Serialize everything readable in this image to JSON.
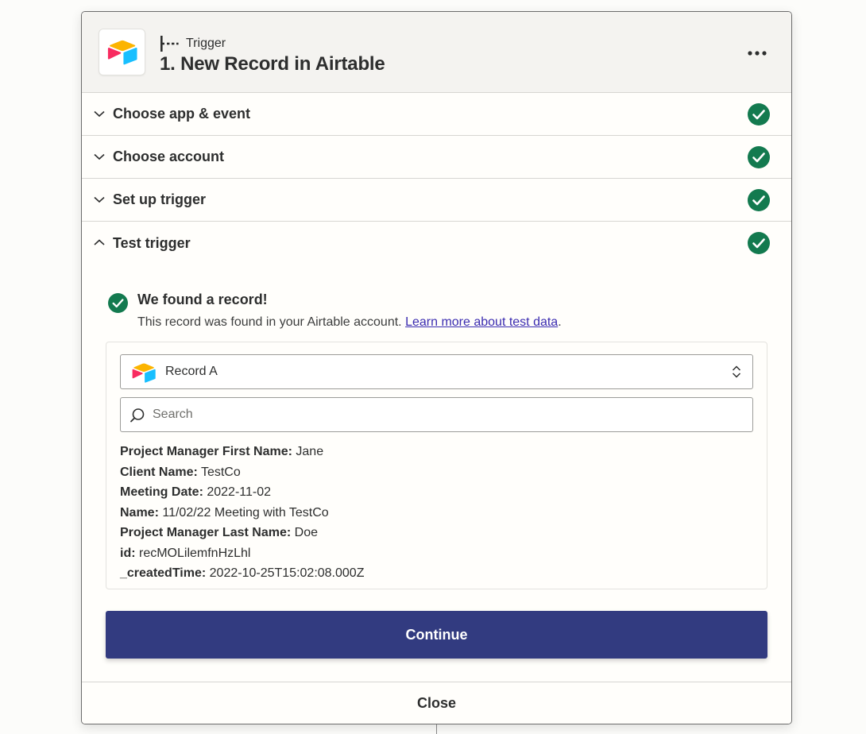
{
  "step": {
    "kind_label": "Trigger",
    "title": "1. New Record in Airtable",
    "app_icon": "airtable-logo"
  },
  "sections": [
    {
      "label": "Choose app & event",
      "expanded": false,
      "complete": true
    },
    {
      "label": "Choose account",
      "expanded": false,
      "complete": true
    },
    {
      "label": "Set up trigger",
      "expanded": false,
      "complete": true
    },
    {
      "label": "Test trigger",
      "expanded": true,
      "complete": true
    }
  ],
  "test_result": {
    "title": "We found a record!",
    "description": "This record was found in your Airtable account.",
    "link_text": "Learn more about test data",
    "link_suffix": "."
  },
  "record_select": {
    "value": "Record A"
  },
  "search": {
    "placeholder": "Search",
    "value": ""
  },
  "fields": [
    {
      "key": "Project Manager First Name:",
      "value": "Jane"
    },
    {
      "key": "Client Name:",
      "value": "TestCo"
    },
    {
      "key": "Meeting Date:",
      "value": "2022-11-02"
    },
    {
      "key": "Name:",
      "value": "11/02/22 Meeting with TestCo"
    },
    {
      "key": "Project Manager Last Name:",
      "value": "Doe"
    },
    {
      "key": "id:",
      "value": "recMOLilemfnHzLhl"
    },
    {
      "key": "_createdTime:",
      "value": "2022-10-25T15:02:08.000Z"
    }
  ],
  "buttons": {
    "continue": "Continue",
    "close": "Close"
  },
  "colors": {
    "success": "#137a4f",
    "primary": "#323b80",
    "link": "#3b2cb0"
  }
}
